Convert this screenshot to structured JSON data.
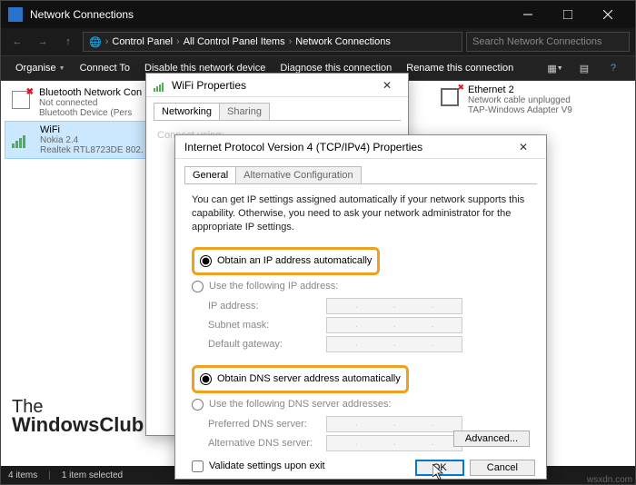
{
  "window": {
    "title": "Network Connections",
    "breadcrumb": [
      "Control Panel",
      "All Control Panel Items",
      "Network Connections"
    ],
    "search_placeholder": "Search Network Connections"
  },
  "cmdbar": {
    "organise": "Organise",
    "connect": "Connect To",
    "disable": "Disable this network device",
    "diagnose": "Diagnose this connection",
    "rename": "Rename this connection"
  },
  "connections": {
    "bluetooth": {
      "name": "Bluetooth Network Con",
      "status": "Not connected",
      "device": "Bluetooth Device (Pers"
    },
    "wifi": {
      "name": "WiFi",
      "status": "Nokia 2.4",
      "device": "Realtek RTL8723DE 802."
    },
    "ethernet": {
      "name": "Ethernet 2",
      "status": "Network cable unplugged",
      "device": "TAP-Windows Adapter V9"
    }
  },
  "wifi_dlg": {
    "title": "WiFi Properties",
    "tabs": {
      "networking": "Networking",
      "sharing": "Sharing"
    },
    "connect_label": "Connect using:"
  },
  "ipv4_dlg": {
    "title": "Internet Protocol Version 4 (TCP/IPv4) Properties",
    "tabs": {
      "general": "General",
      "alt": "Alternative Configuration"
    },
    "intro": "You can get IP settings assigned automatically if your network supports this capability. Otherwise, you need to ask your network administrator for the appropriate IP settings.",
    "radio_auto_ip": "Obtain an IP address automatically",
    "radio_manual_ip": "Use the following IP address:",
    "ip_label": "IP address:",
    "subnet_label": "Subnet mask:",
    "gateway_label": "Default gateway:",
    "radio_auto_dns": "Obtain DNS server address automatically",
    "radio_manual_dns": "Use the following DNS server addresses:",
    "pref_dns_label": "Preferred DNS server:",
    "alt_dns_label": "Alternative DNS server:",
    "validate_label": "Validate settings upon exit",
    "advanced": "Advanced...",
    "ok": "OK",
    "cancel": "Cancel"
  },
  "status": {
    "items": "4 items",
    "selected": "1 item selected"
  },
  "watermark": {
    "l1": "The",
    "l2": "WindowsClub",
    "site": "wsxdn.com"
  }
}
